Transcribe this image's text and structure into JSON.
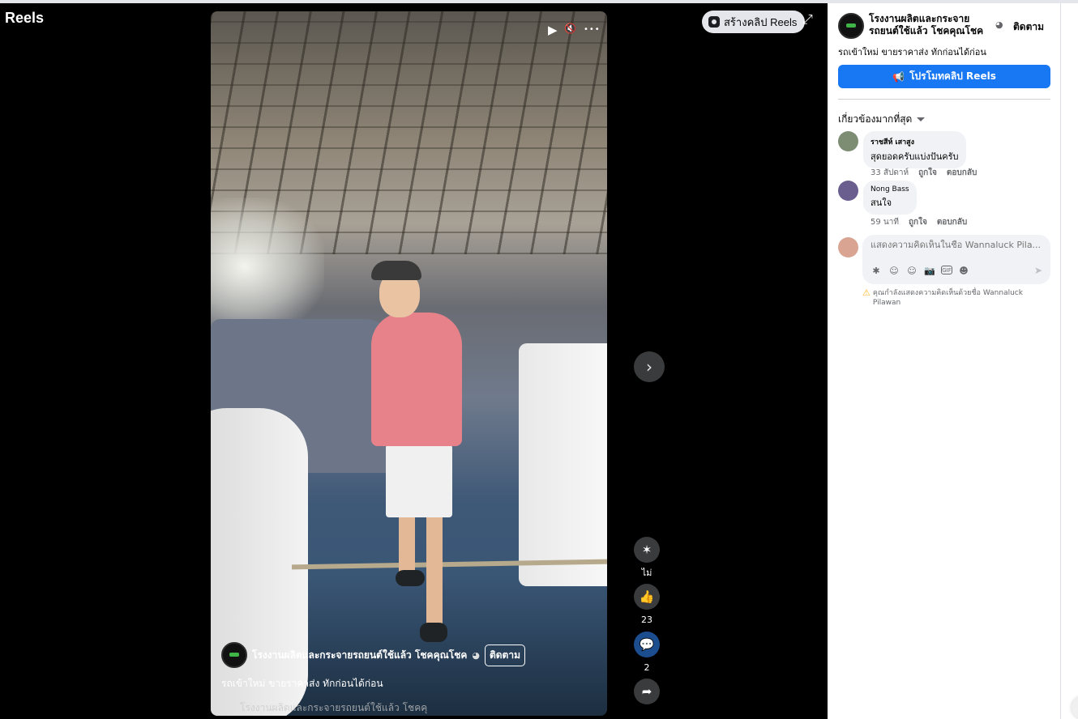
{
  "page_title": "Reels",
  "video_controls": {
    "play_icon": "▶",
    "mute_icon": "🔇",
    "more_icon": "•••"
  },
  "create_reels_label": "สร้างคลิป Reels",
  "expand_icon": "⤢",
  "next_icon": "›",
  "actions": [
    {
      "name": "remix",
      "icon": "✶",
      "count": "ไม่"
    },
    {
      "name": "like",
      "icon": "👍",
      "count": "23"
    },
    {
      "name": "comment",
      "icon": "💬",
      "count": "2"
    },
    {
      "name": "share",
      "icon": "➦",
      "count": ""
    }
  ],
  "video_overlay": {
    "owner_name": "โรงงานผลิตและกระจายรถยนต์ใช้แล้ว โชคคุณโชค",
    "follow_label": "ติดตาม",
    "caption": "รถเข้าใหม่ ขายราคาส่ง ทักก่อนได้ก่อน",
    "audio_text": "โรงงานผลิตและกระจายรถยนต์ใช้แล้ว โชคคุ"
  },
  "panel": {
    "owner_name": "โรงงานผลิตและกระจาย รถยนต์ใช้แล้ว โชคคุณโชค",
    "follow_label": "ติดตาม",
    "caption": "รถเข้าใหม่ ขายราคาส่ง ทักก่อนได้ก่อน",
    "promote_label": "โปรโมทคลิป Reels",
    "sort_label": "เกี่ยวข้องมากที่สุด",
    "comments": [
      {
        "author": "ราชสีห์ เสาสูง",
        "text": "สุดยอดครับแบ่งปันครับ",
        "time": "33 สัปดาห์",
        "like": "ถูกใจ",
        "reply": "ตอบกลับ"
      },
      {
        "author": "Nong Bass",
        "text": "สนใจ",
        "time": "59 นาที",
        "like": "ถูกใจ",
        "reply": "ตอบกลับ"
      }
    ],
    "compose_placeholder": "แสดงความคิดเห็นในชื่อ Wannaluck Pila...",
    "compose_icons": [
      "✱",
      "☺",
      "☺",
      "📷",
      "GIF",
      "☻"
    ],
    "send_icon": "➤",
    "notice": "คุณกำลังแสดงความคิดเห็นด้วยชื่อ Wannaluck Pilawan"
  }
}
